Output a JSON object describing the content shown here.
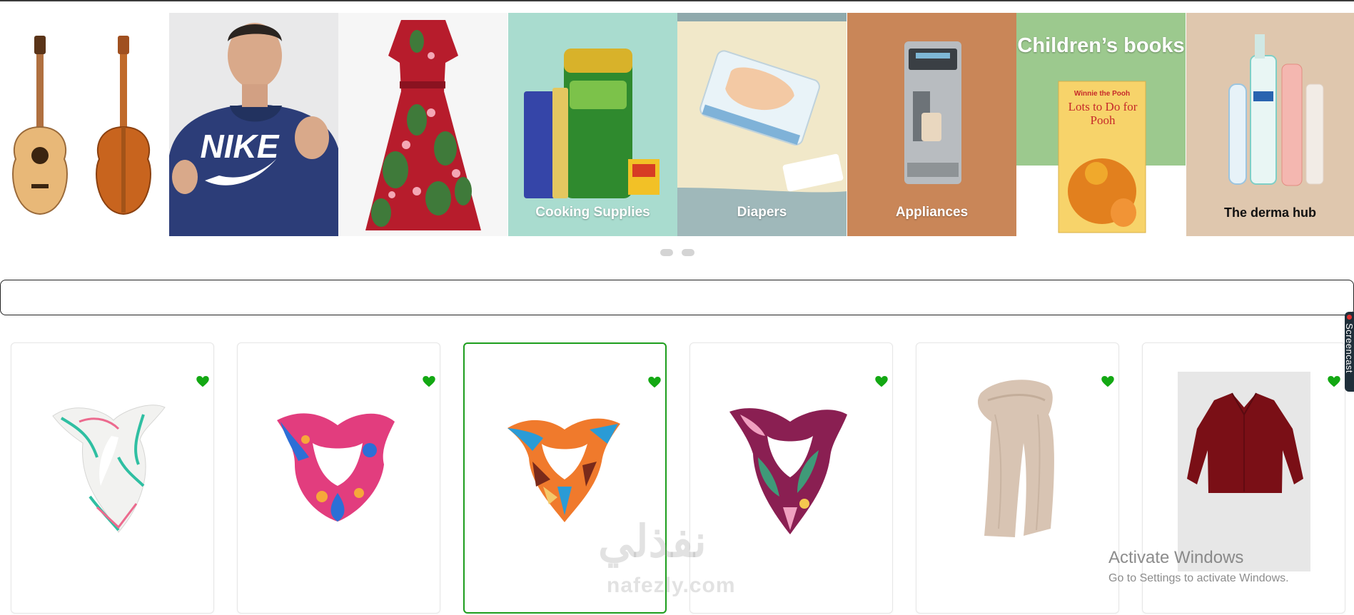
{
  "carousel": {
    "tiles": [
      {
        "name": "guitars",
        "caption": ""
      },
      {
        "name": "hoodie",
        "caption": "",
        "brand_print": "NIKE"
      },
      {
        "name": "dress",
        "caption": ""
      },
      {
        "name": "cooking-supplies",
        "caption": "Cooking Supplies"
      },
      {
        "name": "diapers",
        "caption": "Diapers"
      },
      {
        "name": "appliances",
        "caption": "Appliances"
      },
      {
        "name": "childrens-books",
        "caption": "Children’s books",
        "book_title": "Lots to Do for Pooh",
        "book_brand": "Winnie the Pooh"
      },
      {
        "name": "derma-hub",
        "caption": "The derma hub"
      }
    ],
    "page_dots": 2
  },
  "search": {
    "value": "",
    "placeholder": ""
  },
  "products": [
    {
      "name": "scarf-white-floral",
      "icon": "heart-icon",
      "selected": false
    },
    {
      "name": "scarf-pink-blue",
      "icon": "heart-icon",
      "selected": false
    },
    {
      "name": "scarf-orange-geometric",
      "icon": "heart-icon",
      "selected": true
    },
    {
      "name": "scarf-burgundy-floral",
      "icon": "heart-icon",
      "selected": false
    },
    {
      "name": "scarf-beige",
      "icon": "heart-icon",
      "selected": false
    },
    {
      "name": "shirt-burgundy",
      "icon": "heart-icon",
      "selected": false
    }
  ],
  "side_tab": {
    "label": "Screencast"
  },
  "watermark": {
    "arabic": "نفذلي",
    "latin": "nafezly.com"
  },
  "os_notice": {
    "title": "Activate Windows",
    "subtitle": "Go to Settings to activate Windows."
  },
  "colors": {
    "accent_green": "#1e9e1e",
    "heart_green": "#13a813",
    "top_line": "#3a3a3a"
  }
}
